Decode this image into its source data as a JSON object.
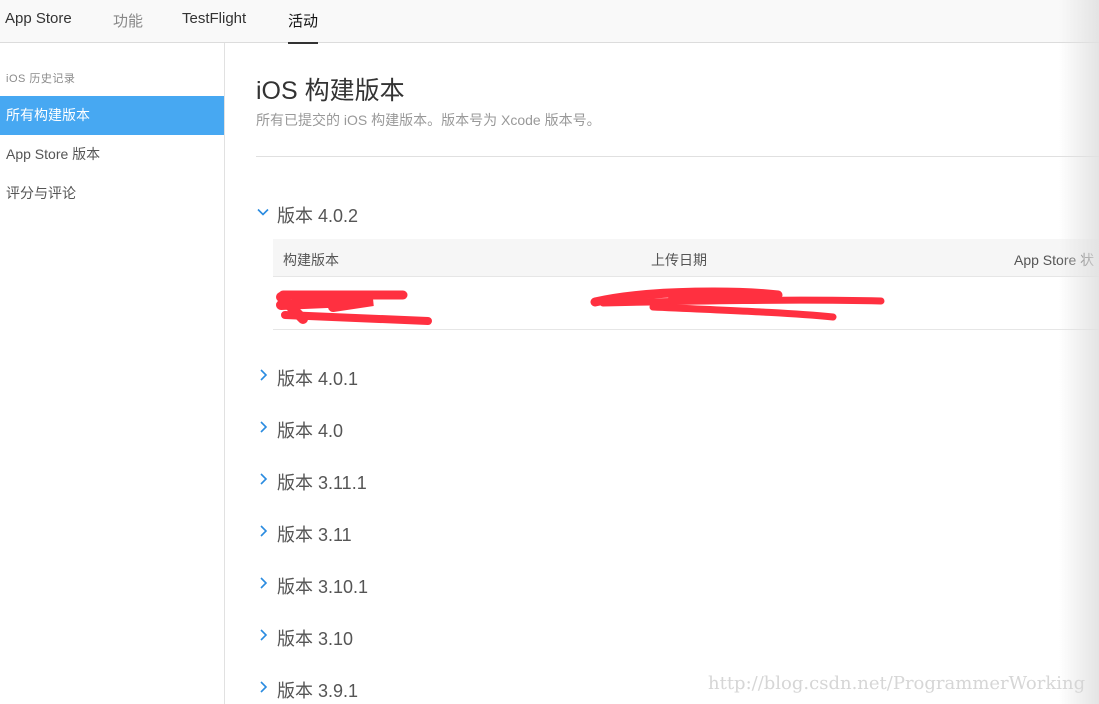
{
  "topnav": {
    "tabs": [
      {
        "label": "App Store"
      },
      {
        "label": "功能"
      },
      {
        "label": "TestFlight"
      },
      {
        "label": "活动"
      }
    ]
  },
  "sidebar": {
    "header": "iOS 历史记录",
    "items": [
      {
        "label": "所有构建版本"
      },
      {
        "label": "App Store 版本"
      },
      {
        "label": "评分与评论"
      }
    ]
  },
  "main": {
    "title": "iOS 构建版本",
    "subtitle": "所有已提交的 iOS 构建版本。版本号为 Xcode 版本号。",
    "versions": [
      {
        "label": "版本 4.0.2",
        "expanded": true
      },
      {
        "label": "版本 4.0.1",
        "expanded": false
      },
      {
        "label": "版本 4.0",
        "expanded": false
      },
      {
        "label": "版本 3.11.1",
        "expanded": false
      },
      {
        "label": "版本 3.11",
        "expanded": false
      },
      {
        "label": "版本 3.10.1",
        "expanded": false
      },
      {
        "label": "版本 3.10",
        "expanded": false
      },
      {
        "label": "版本 3.9.1",
        "expanded": false
      }
    ],
    "table": {
      "columns": [
        "构建版本",
        "上传日期",
        "App Store 状"
      ]
    }
  },
  "colors": {
    "selected": "#47a8f2",
    "chevron": "#2a8be0",
    "redaction": "#ff3040"
  },
  "watermark": "http://blog.csdn.net/ProgrammerWorking"
}
